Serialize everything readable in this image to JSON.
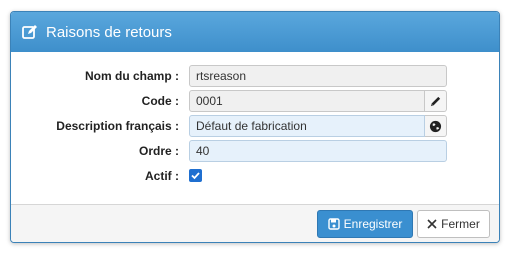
{
  "dialog": {
    "title": "Raisons de retours",
    "title_icon": "edit-square-icon"
  },
  "form": {
    "field_name": {
      "label": "Nom du champ :",
      "value": "rtsreason"
    },
    "code": {
      "label": "Code :",
      "value": "0001",
      "addon_icon": "pencil-icon"
    },
    "description": {
      "label": "Description français :",
      "value": "Défaut de fabrication",
      "addon_icon": "globe-icon"
    },
    "order": {
      "label": "Ordre :",
      "value": "40"
    },
    "active": {
      "label": "Actif :",
      "checked": true
    }
  },
  "footer": {
    "save_label": "Enregistrer",
    "save_icon": "floppy-disk-icon",
    "close_label": "Fermer",
    "close_icon": "close-icon"
  },
  "colors": {
    "header": "#3e8fcb",
    "primary_button": "#3a8fd0",
    "checkbox": "#1f6fd0"
  }
}
